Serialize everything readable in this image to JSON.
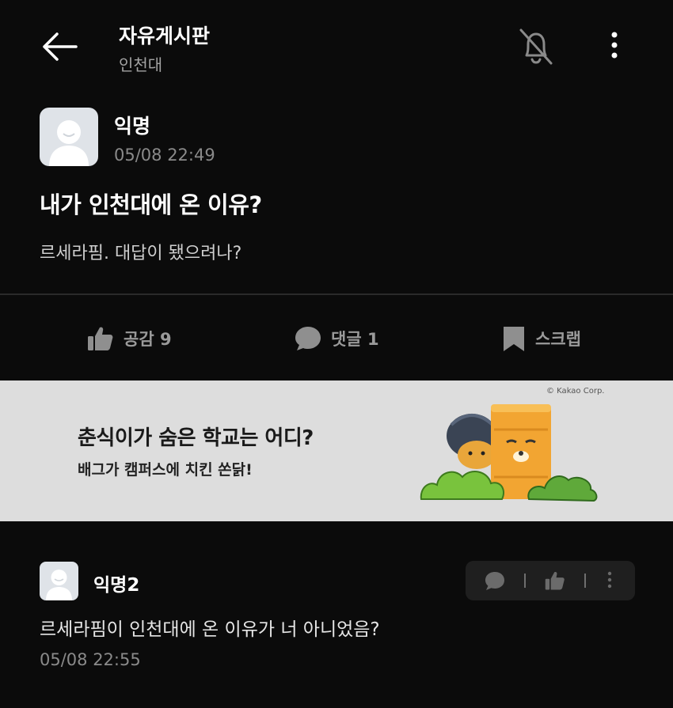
{
  "header": {
    "title": "자유게시판",
    "subtitle": "인천대"
  },
  "post": {
    "author": "익명",
    "timestamp": "05/08 22:49",
    "title": "내가 인천대에 온 이유?",
    "body": "르세라핌. 대답이 됐으려나?"
  },
  "actions": {
    "like_label": "공감 9",
    "comment_label": "댓글 1",
    "scrap_label": "스크랩"
  },
  "banner": {
    "title": "춘식이가 숨은 학교는 어디?",
    "subtitle": "배그가 캠퍼스에 치킨 쏜닭!",
    "credit": "© Kakao Corp."
  },
  "comment": {
    "author": "익명2",
    "body": "르세라핌이 인천대에 온 이유가 너 아니었음?",
    "timestamp": "05/08 22:55"
  },
  "icons": {
    "back": "arrow-left-icon",
    "bell_off": "bell-off-icon",
    "more": "more-vertical-icon",
    "like": "thumbs-up-icon",
    "comment": "speech-bubble-icon",
    "scrap": "bookmark-icon"
  },
  "colors": {
    "background": "#0b0b0b",
    "muted_text": "#9a9a9a",
    "banner_bg": "#dddddd"
  }
}
